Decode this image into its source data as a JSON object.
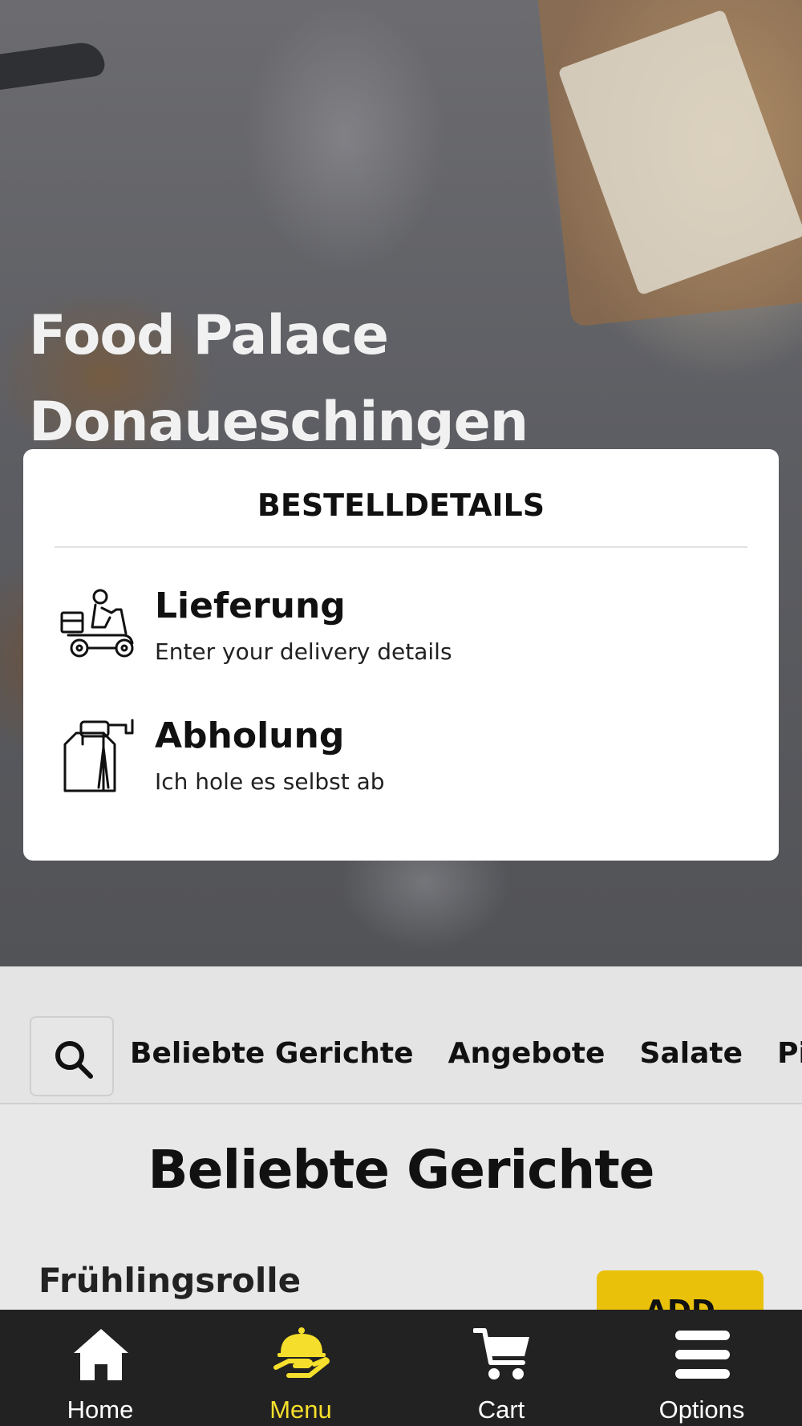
{
  "hero": {
    "title_line1": "Food Palace",
    "title_line2": "Donaueschingen"
  },
  "order_card": {
    "title": "BESTELLDETAILS",
    "options": [
      {
        "title": "Lieferung",
        "subtitle": "Enter your delivery details",
        "icon": "scooter-icon"
      },
      {
        "title": "Abholung",
        "subtitle": "Ich hole es selbst ab",
        "icon": "takeaway-bag-icon"
      }
    ]
  },
  "categories": {
    "search_icon": "search-icon",
    "items": [
      "Beliebte Gerichte",
      "Angebote",
      "Salate",
      "Pizza"
    ]
  },
  "section": {
    "title": "Beliebte Gerichte",
    "dish_name": "Frühlingsrolle",
    "add_label": "ADD"
  },
  "bottom_nav": {
    "items": [
      {
        "label": "Home",
        "icon": "home-icon",
        "active": false
      },
      {
        "label": "Menu",
        "icon": "cloche-icon",
        "active": true
      },
      {
        "label": "Cart",
        "icon": "cart-icon",
        "active": false
      },
      {
        "label": "Options",
        "icon": "menu-icon",
        "active": false
      }
    ]
  },
  "colors": {
    "accent": "#e9c10a",
    "active_nav": "#f5df2c",
    "nav_bg": "#222222"
  }
}
